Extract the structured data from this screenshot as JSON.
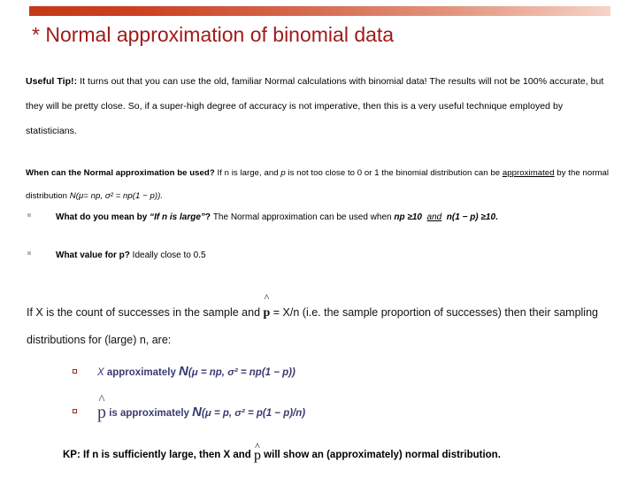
{
  "slide": {
    "title": "* Normal approximation of binomial data",
    "title_color": "#A21A1A",
    "accent_bar": {
      "gradient_from": "#C33A16",
      "gradient_to": "#F5D5C8"
    },
    "useful_tip": {
      "label": "Useful Tip!:",
      "body": " It turns out that you can use the old, familiar Normal calculations with binomial data! The results will not be 100% accurate, but they will be pretty close. So, if a super-high degree of accuracy is not imperative, then this is a very useful technique employed by statisticians."
    },
    "when_used": {
      "label": "When can the Normal approximation be used?",
      "part1": "  If n is large, and ",
      "var_p": "p",
      "part2": " is not too close to 0 or 1 the binomial distribution can be ",
      "underlined_word": "approximated",
      "part3": " by the normal distribution ",
      "formula": "N(μ= np, σ² = np(1 − p))."
    },
    "bullets": [
      {
        "lead": "What do you mean by ",
        "quoted": "“If n is large”",
        "after_quote": "? ",
        "body": "The Normal approximation can be used when ",
        "cond1": "np ≥10",
        "joiner": "and",
        "cond2": "n(1 − p) ≥10",
        "tail": "."
      },
      {
        "lead": "What value for p?",
        "body": "  Ideally close to 0.5"
      }
    ],
    "mid_paragraph": {
      "part1": "If X is the count of successes in the sample and  ",
      "phat": "p",
      "part2": " = X/n (i.e. the sample proportion of successes) then their sampling distributions for (large) n, are:"
    },
    "formula_bullets": [
      {
        "prefix": "X",
        "text": " approximately ",
        "bigN": "N",
        "formula": "(μ = np, σ² = np(1 − p))"
      },
      {
        "prefix_phat": "p",
        "text": " is approximately ",
        "bigN": "N",
        "formula": "(μ = p, σ² = p(1 − p)/n)"
      }
    ],
    "kp": {
      "part1": "KP: If n is sufficiently large, then X and ",
      "phat": "p",
      "part2": " will show an (approximately) normal distribution."
    }
  }
}
